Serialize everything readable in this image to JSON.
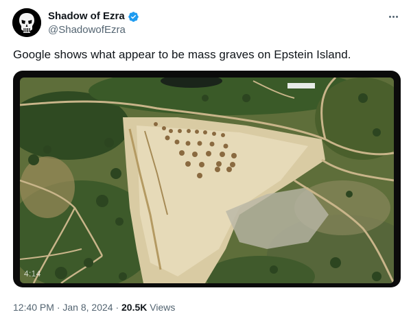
{
  "author": {
    "display_name": "Shadow of Ezra",
    "handle": "@ShadowofEzra",
    "verified": true,
    "avatar_icon": "punisher-skull-icon"
  },
  "tweet": {
    "text": "Google shows what appear to be mass graves on Epstein Island."
  },
  "media": {
    "type": "video",
    "duration": "4:14"
  },
  "meta": {
    "time": "12:40 PM",
    "separator1": " · ",
    "date": "Jan 8, 2024",
    "separator2": " · ",
    "views_count": "20.5K",
    "views_label": " Views"
  },
  "colors": {
    "verified_blue": "#1d9bf0",
    "text_primary": "#0f1419",
    "text_secondary": "#536471"
  }
}
